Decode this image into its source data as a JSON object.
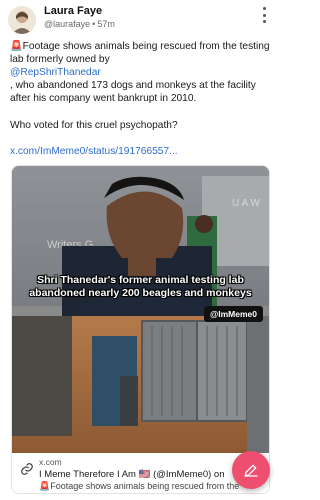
{
  "post": {
    "author": {
      "name": "Laura Faye",
      "handle": "@laurafaye",
      "time": "57m"
    },
    "text": {
      "line1": "🚨Footage shows animals being rescued from the testing lab formerly owned by",
      "mention": "@RepShriThanedar",
      "line2": ", who abandoned 173 dogs and monkeys at the facility after his company went bankrupt in 2010.",
      "question": "Who voted for this cruel psychopath?",
      "link": "x.com/ImMeme0/status/191766557..."
    }
  },
  "card": {
    "caption_line1": "Shri Thanedar's former animal testing lab",
    "caption_line2": "abandoned nearly 200 beagles and monkeys",
    "image_handle": "@ImMeme0",
    "sign_text": "Writers G",
    "domain": "x.com",
    "title": "I Meme Therefore I Am 🇺🇸 (@ImMeme0) on",
    "description": "🚨Footage shows animals being rescued from the"
  },
  "icons": {
    "menu": "more-vertical-icon",
    "link": "link-icon",
    "compose": "edit-icon"
  },
  "colors": {
    "link": "#2e6ec9",
    "fab": "#ee4f6f"
  }
}
